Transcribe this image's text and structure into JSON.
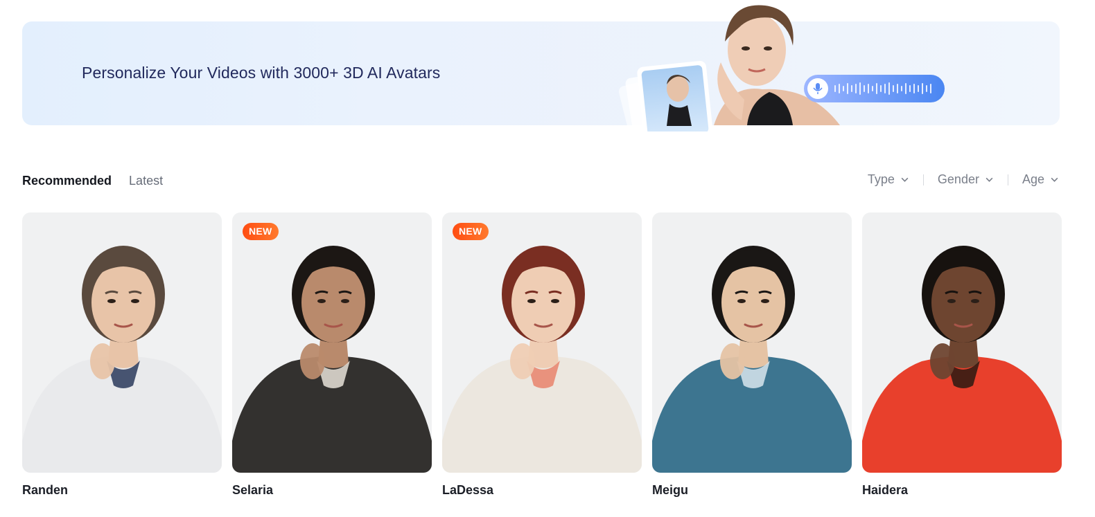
{
  "banner": {
    "title": "Personalize Your Videos with 3000+ 3D AI Avatars"
  },
  "tabs": [
    {
      "label": "Recommended",
      "active": true
    },
    {
      "label": "Latest",
      "active": false
    }
  ],
  "filters": [
    {
      "label": "Type",
      "icon": "chevron-down-icon"
    },
    {
      "label": "Gender",
      "icon": "chevron-down-icon"
    },
    {
      "label": "Age",
      "icon": "chevron-down-icon"
    }
  ],
  "avatars": [
    {
      "name": "Randen",
      "badge": "",
      "skin": "#e8c4a8",
      "hair": "#5a4a3e",
      "outfit": "#e9eaec",
      "accent": "#2a3a5c"
    },
    {
      "name": "Selaria",
      "badge": "NEW",
      "skin": "#b98a6c",
      "hair": "#1c1714",
      "outfit": "#33312f",
      "accent": "#e8e2d8"
    },
    {
      "name": "LaDessa",
      "badge": "NEW",
      "skin": "#efcdb4",
      "hair": "#7a2e22",
      "outfit": "#ece7df",
      "accent": "#e9826c"
    },
    {
      "name": "Meigu",
      "badge": "",
      "skin": "#e5c3a4",
      "hair": "#1a1715",
      "outfit": "#3d7590",
      "accent": "#d8e6ef"
    },
    {
      "name": "Haidera",
      "badge": "",
      "skin": "#6e4530",
      "hair": "#17120f",
      "outfit": "#e8402c",
      "accent": "#2a1a12"
    }
  ],
  "colors": {
    "banner_title": "#21295c",
    "badge": "#ff5a1f",
    "voice_pill": "#5b8df5"
  }
}
